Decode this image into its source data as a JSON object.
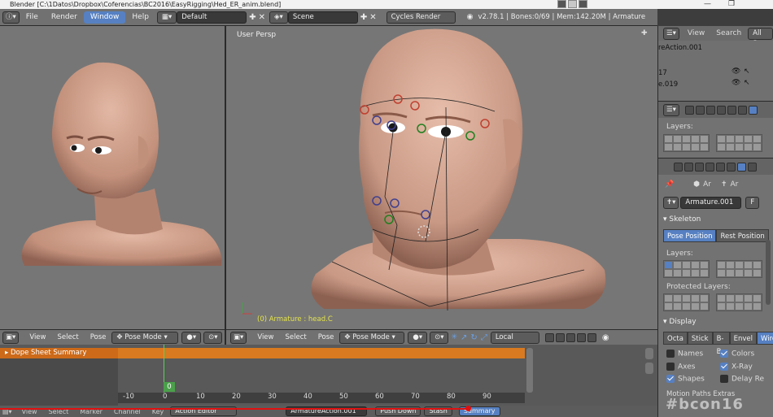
{
  "window_title": "Blender [C:\\1Datos\\Dropbox\\Coferencias\\BC2016\\EasyRigging\\Hed_ER_anim.blend]",
  "menu": {
    "file": "File",
    "render": "Render",
    "window": "Window",
    "help": "Help"
  },
  "layout_name": "Default",
  "scene_name": "Scene",
  "render_engine": "Cycles Render",
  "stats": "v2.78.1 | Bones:0/69 | Mem:142.20M | Armature",
  "left_viewport": {
    "header": {
      "view": "View",
      "select": "Select",
      "pose": "Pose",
      "mode": "Pose Mode"
    }
  },
  "right_viewport": {
    "label": "User Persp",
    "object_info": "(0) Armature : head.C",
    "header": {
      "view": "View",
      "select": "Select",
      "pose": "Pose",
      "mode": "Pose Mode",
      "orientation": "Local"
    }
  },
  "outliner": {
    "view": "View",
    "search": "Search",
    "filter": "All Sce",
    "rows": [
      "reAction.001",
      "17",
      "e.019"
    ]
  },
  "properties": {
    "layers_label": "Layers:",
    "breadcrumb": [
      "Ar",
      "Ar"
    ],
    "armature_name": "Armature.001",
    "fake_user": "F",
    "skeleton_title": "Skeleton",
    "pose_position": "Pose Position",
    "rest_position": "Rest Position",
    "skeleton_layers": "Layers:",
    "protected_layers": "Protected Layers:",
    "display_title": "Display",
    "display_modes": [
      "Octa",
      "Stick",
      "B-Bo",
      "Envel",
      "Wire"
    ],
    "active_mode": "Wire",
    "options": [
      {
        "label": "Names",
        "checked": false
      },
      {
        "label": "Colors",
        "checked": true
      },
      {
        "label": "Axes",
        "checked": false
      },
      {
        "label": "X-Ray",
        "checked": true
      },
      {
        "label": "Shapes",
        "checked": true
      },
      {
        "label": "Delay Re",
        "checked": false
      }
    ],
    "motion_paths": "Motion Paths Extras"
  },
  "timeline": {
    "channel": "Dope Sheet Summary",
    "current_frame": "0",
    "ticks": [
      "-10",
      "0",
      "10",
      "20",
      "30",
      "40",
      "50",
      "60",
      "70",
      "80",
      "90"
    ]
  },
  "bottom_header": {
    "view": "View",
    "select": "Select",
    "marker": "Marker",
    "channel": "Channel",
    "key": "Key",
    "editor": "Action Editor",
    "action": "ArmatureAction.001",
    "push_down": "Push Down",
    "stash": "Stash",
    "summary": "Summary"
  },
  "watermark": "#bcon16"
}
